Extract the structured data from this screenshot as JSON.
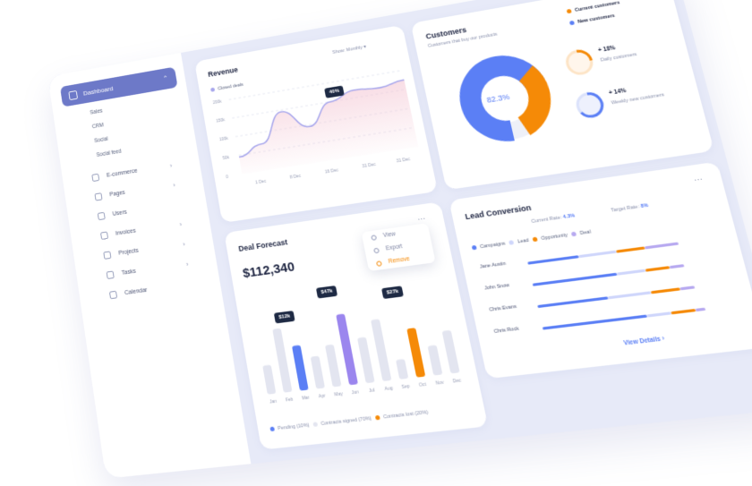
{
  "sidebar": {
    "dashboard_label": "Dashboard",
    "sub_items": [
      "Sales",
      "CRM",
      "Social",
      "Social feed"
    ],
    "items": [
      {
        "label": "E-commerce",
        "icon": "cart-icon",
        "has_chevron": true
      },
      {
        "label": "Pages",
        "icon": "pages-icon",
        "has_chevron": true
      },
      {
        "label": "Users",
        "icon": "users-icon",
        "has_chevron": false
      },
      {
        "label": "Invoices",
        "icon": "invoice-icon",
        "has_chevron": true
      },
      {
        "label": "Projects",
        "icon": "projects-icon",
        "has_chevron": true
      },
      {
        "label": "Tasks",
        "icon": "tasks-icon",
        "has_chevron": true
      },
      {
        "label": "Calendar",
        "icon": "calendar-icon",
        "has_chevron": false
      }
    ]
  },
  "revenue": {
    "title": "Revenue",
    "show_label": "Show:",
    "show_value": "Monthly",
    "legend": "Closed deals",
    "tooltip": "40%",
    "chart_data": {
      "type": "area",
      "x": [
        "1 Dec",
        "8 Dec",
        "16 Dec",
        "31 Dec",
        "31 Dec"
      ],
      "y_ticks": [
        "200k",
        "150k",
        "100k",
        "50k",
        "0"
      ],
      "values": [
        45,
        70,
        145,
        95,
        150,
        170,
        165,
        175
      ],
      "ylim": [
        0,
        200
      ]
    }
  },
  "customers": {
    "title": "Customers",
    "subtitle": "Customers that buy our products",
    "legend_current": "Current customers",
    "legend_new": "New customers",
    "center_value": "82.3%",
    "stat1_value": "+ 18%",
    "stat1_label": "Daily customers",
    "stat2_value": "+ 14%",
    "stat2_label": "Weekly new customers",
    "colors": {
      "current": "#f58a07",
      "new": "#5b7ff5"
    },
    "chart_data": {
      "type": "pie",
      "slices": [
        {
          "name": "Current customers",
          "value": 30
        },
        {
          "name": "New customers",
          "value": 70
        }
      ]
    }
  },
  "deal_forecast": {
    "title": "Deal Forecast",
    "amount": "$112,340",
    "menu": [
      "View",
      "Export",
      "Remove"
    ],
    "tooltips": [
      "$12k",
      "$47k",
      "$27k"
    ],
    "legend": [
      "Pending (10%)",
      "Contracts signed (70%)",
      "Contracts lost (20%)"
    ],
    "chart_data": {
      "type": "bar",
      "categories": [
        "Jan",
        "Feb",
        "Mar",
        "Apr",
        "May",
        "Jun",
        "Jul",
        "Aug",
        "Sep",
        "Oct",
        "Nov",
        "Dec"
      ],
      "values": [
        18,
        40,
        28,
        20,
        26,
        44,
        28,
        38,
        12,
        30,
        18,
        26
      ],
      "highlight": {
        "Mar": "pending",
        "Jun": "signed",
        "Oct": "lost"
      }
    }
  },
  "lead_conversion": {
    "title": "Lead Conversion",
    "current_rate_label": "Current Rate:",
    "current_rate_value": "4.3%",
    "target_rate_label": "Target Rate:",
    "target_rate_value": "8%",
    "legend": [
      "Campaigns",
      "Lead",
      "Opportunity",
      "Deal"
    ],
    "rows": [
      "Jane Austin",
      "John Snow",
      "Chris Evans",
      "Chris Rock"
    ],
    "link": "View Details"
  }
}
